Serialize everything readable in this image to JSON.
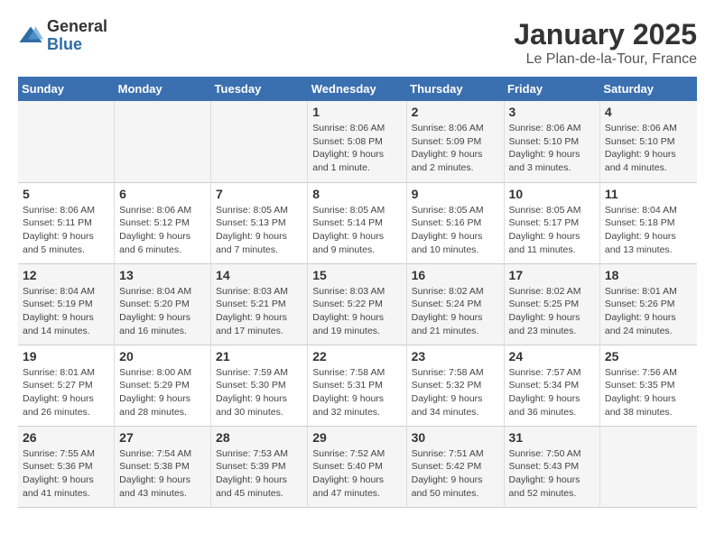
{
  "header": {
    "logo_general": "General",
    "logo_blue": "Blue",
    "month_title": "January 2025",
    "location": "Le Plan-de-la-Tour, France"
  },
  "days_of_week": [
    "Sunday",
    "Monday",
    "Tuesday",
    "Wednesday",
    "Thursday",
    "Friday",
    "Saturday"
  ],
  "weeks": [
    [
      {
        "day": "",
        "info": ""
      },
      {
        "day": "",
        "info": ""
      },
      {
        "day": "",
        "info": ""
      },
      {
        "day": "1",
        "info": "Sunrise: 8:06 AM\nSunset: 5:08 PM\nDaylight: 9 hours\nand 1 minute."
      },
      {
        "day": "2",
        "info": "Sunrise: 8:06 AM\nSunset: 5:09 PM\nDaylight: 9 hours\nand 2 minutes."
      },
      {
        "day": "3",
        "info": "Sunrise: 8:06 AM\nSunset: 5:10 PM\nDaylight: 9 hours\nand 3 minutes."
      },
      {
        "day": "4",
        "info": "Sunrise: 8:06 AM\nSunset: 5:10 PM\nDaylight: 9 hours\nand 4 minutes."
      }
    ],
    [
      {
        "day": "5",
        "info": "Sunrise: 8:06 AM\nSunset: 5:11 PM\nDaylight: 9 hours\nand 5 minutes."
      },
      {
        "day": "6",
        "info": "Sunrise: 8:06 AM\nSunset: 5:12 PM\nDaylight: 9 hours\nand 6 minutes."
      },
      {
        "day": "7",
        "info": "Sunrise: 8:05 AM\nSunset: 5:13 PM\nDaylight: 9 hours\nand 7 minutes."
      },
      {
        "day": "8",
        "info": "Sunrise: 8:05 AM\nSunset: 5:14 PM\nDaylight: 9 hours\nand 9 minutes."
      },
      {
        "day": "9",
        "info": "Sunrise: 8:05 AM\nSunset: 5:16 PM\nDaylight: 9 hours\nand 10 minutes."
      },
      {
        "day": "10",
        "info": "Sunrise: 8:05 AM\nSunset: 5:17 PM\nDaylight: 9 hours\nand 11 minutes."
      },
      {
        "day": "11",
        "info": "Sunrise: 8:04 AM\nSunset: 5:18 PM\nDaylight: 9 hours\nand 13 minutes."
      }
    ],
    [
      {
        "day": "12",
        "info": "Sunrise: 8:04 AM\nSunset: 5:19 PM\nDaylight: 9 hours\nand 14 minutes."
      },
      {
        "day": "13",
        "info": "Sunrise: 8:04 AM\nSunset: 5:20 PM\nDaylight: 9 hours\nand 16 minutes."
      },
      {
        "day": "14",
        "info": "Sunrise: 8:03 AM\nSunset: 5:21 PM\nDaylight: 9 hours\nand 17 minutes."
      },
      {
        "day": "15",
        "info": "Sunrise: 8:03 AM\nSunset: 5:22 PM\nDaylight: 9 hours\nand 19 minutes."
      },
      {
        "day": "16",
        "info": "Sunrise: 8:02 AM\nSunset: 5:24 PM\nDaylight: 9 hours\nand 21 minutes."
      },
      {
        "day": "17",
        "info": "Sunrise: 8:02 AM\nSunset: 5:25 PM\nDaylight: 9 hours\nand 23 minutes."
      },
      {
        "day": "18",
        "info": "Sunrise: 8:01 AM\nSunset: 5:26 PM\nDaylight: 9 hours\nand 24 minutes."
      }
    ],
    [
      {
        "day": "19",
        "info": "Sunrise: 8:01 AM\nSunset: 5:27 PM\nDaylight: 9 hours\nand 26 minutes."
      },
      {
        "day": "20",
        "info": "Sunrise: 8:00 AM\nSunset: 5:29 PM\nDaylight: 9 hours\nand 28 minutes."
      },
      {
        "day": "21",
        "info": "Sunrise: 7:59 AM\nSunset: 5:30 PM\nDaylight: 9 hours\nand 30 minutes."
      },
      {
        "day": "22",
        "info": "Sunrise: 7:58 AM\nSunset: 5:31 PM\nDaylight: 9 hours\nand 32 minutes."
      },
      {
        "day": "23",
        "info": "Sunrise: 7:58 AM\nSunset: 5:32 PM\nDaylight: 9 hours\nand 34 minutes."
      },
      {
        "day": "24",
        "info": "Sunrise: 7:57 AM\nSunset: 5:34 PM\nDaylight: 9 hours\nand 36 minutes."
      },
      {
        "day": "25",
        "info": "Sunrise: 7:56 AM\nSunset: 5:35 PM\nDaylight: 9 hours\nand 38 minutes."
      }
    ],
    [
      {
        "day": "26",
        "info": "Sunrise: 7:55 AM\nSunset: 5:36 PM\nDaylight: 9 hours\nand 41 minutes."
      },
      {
        "day": "27",
        "info": "Sunrise: 7:54 AM\nSunset: 5:38 PM\nDaylight: 9 hours\nand 43 minutes."
      },
      {
        "day": "28",
        "info": "Sunrise: 7:53 AM\nSunset: 5:39 PM\nDaylight: 9 hours\nand 45 minutes."
      },
      {
        "day": "29",
        "info": "Sunrise: 7:52 AM\nSunset: 5:40 PM\nDaylight: 9 hours\nand 47 minutes."
      },
      {
        "day": "30",
        "info": "Sunrise: 7:51 AM\nSunset: 5:42 PM\nDaylight: 9 hours\nand 50 minutes."
      },
      {
        "day": "31",
        "info": "Sunrise: 7:50 AM\nSunset: 5:43 PM\nDaylight: 9 hours\nand 52 minutes."
      },
      {
        "day": "",
        "info": ""
      }
    ]
  ]
}
